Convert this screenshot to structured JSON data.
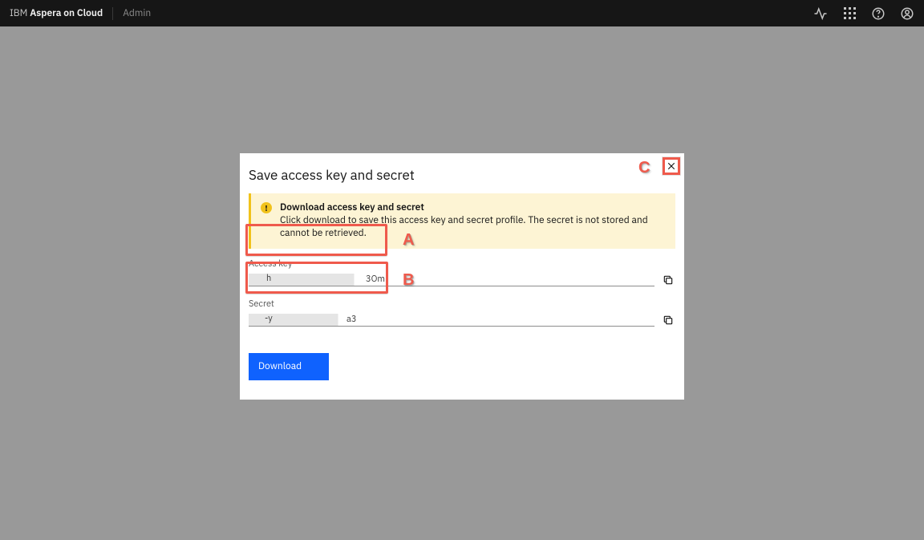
{
  "header": {
    "brand_prefix": "IBM ",
    "brand_main": "Aspera on Cloud",
    "section": "Admin"
  },
  "modal": {
    "title": "Save access key and secret",
    "notice_title": "Download access key and secret",
    "notice_body": "Click download to save this access key and secret profile. The secret is not stored and cannot be retrieved.",
    "access_key_label": "Access key",
    "access_key_left": "h",
    "access_key_right": "3Om",
    "secret_label": "Secret",
    "secret_left": "-y",
    "secret_right": "a3",
    "download_label": "Download"
  },
  "annotations": {
    "a": "A",
    "b": "B",
    "c": "C"
  }
}
